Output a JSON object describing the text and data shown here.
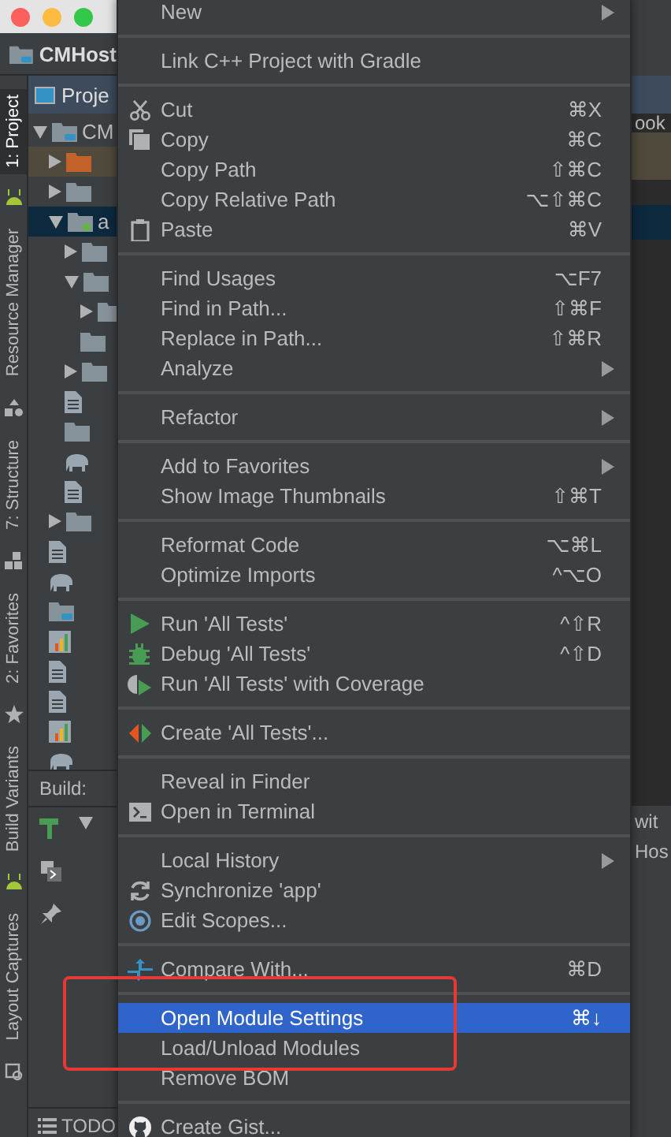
{
  "window": {
    "title": "CMHost"
  },
  "tool_tabs": [
    {
      "label": "1: Project",
      "selected": true,
      "kind": "android"
    },
    {
      "label": "Resource Manager",
      "selected": false,
      "kind": "resource"
    },
    {
      "label": "7: Structure",
      "selected": false,
      "kind": "structure"
    },
    {
      "label": "2: Favorites",
      "selected": false,
      "kind": "star"
    },
    {
      "label": "Build Variants",
      "selected": false,
      "kind": "android"
    },
    {
      "label": "Layout Captures",
      "selected": false,
      "kind": "capture"
    }
  ],
  "project_panel": {
    "title": "Proje",
    "tree": [
      {
        "kind": "module",
        "label": "CM",
        "expanded": true,
        "selected": false,
        "children": [
          {
            "kind": "excluded",
            "expanded": false,
            "selected": false
          },
          {
            "kind": "folder",
            "expanded": false,
            "selected": false
          },
          {
            "kind": "app",
            "label": "a",
            "expanded": true,
            "selected": true,
            "children": [
              {
                "kind": "folder",
                "expanded": false,
                "selected": false
              },
              {
                "kind": "folder",
                "expanded": true,
                "selected": false,
                "children": [
                  {
                    "kind": "folder",
                    "expanded": false,
                    "selected": false
                  },
                  {
                    "kind": "folder",
                    "selected": false
                  }
                ]
              },
              {
                "kind": "folder",
                "expanded": false,
                "selected": false
              },
              {
                "kind": "file",
                "selected": false
              },
              {
                "kind": "folder",
                "selected": false
              },
              {
                "kind": "gradle",
                "selected": false
              },
              {
                "kind": "file",
                "selected": false
              }
            ]
          },
          {
            "kind": "folder",
            "expanded": false,
            "selected": false
          },
          {
            "kind": "file",
            "selected": false
          },
          {
            "kind": "gradle",
            "selected": false
          },
          {
            "kind": "module",
            "selected": false
          },
          {
            "kind": "chart",
            "selected": false
          },
          {
            "kind": "file",
            "selected": false
          },
          {
            "kind": "file",
            "selected": false
          },
          {
            "kind": "chart",
            "selected": false
          },
          {
            "kind": "gradle",
            "selected": false
          }
        ]
      }
    ]
  },
  "build_panel": {
    "label": "Build:"
  },
  "status_bar": {
    "label": "TODO"
  },
  "right_fragments": [
    {
      "text": "ook"
    },
    {
      "text": "wit"
    },
    {
      "text": "Hos"
    }
  ],
  "context_menu": [
    [
      {
        "label": "New",
        "submenu": true
      }
    ],
    [
      {
        "label": "Link C++ Project with Gradle"
      }
    ],
    [
      {
        "label": "Cut",
        "shortcut": "⌘X",
        "kind": "cut"
      },
      {
        "label": "Copy",
        "shortcut": "⌘C",
        "kind": "copy"
      },
      {
        "label": "Copy Path",
        "shortcut": "⇧⌘C"
      },
      {
        "label": "Copy Relative Path",
        "shortcut": "⌥⇧⌘C"
      },
      {
        "label": "Paste",
        "shortcut": "⌘V",
        "kind": "paste"
      }
    ],
    [
      {
        "label": "Find Usages",
        "shortcut": "⌥F7"
      },
      {
        "label": "Find in Path...",
        "shortcut": "⇧⌘F"
      },
      {
        "label": "Replace in Path...",
        "shortcut": "⇧⌘R"
      },
      {
        "label": "Analyze",
        "submenu": true
      }
    ],
    [
      {
        "label": "Refactor",
        "submenu": true
      }
    ],
    [
      {
        "label": "Add to Favorites",
        "submenu": true
      },
      {
        "label": "Show Image Thumbnails",
        "shortcut": "⇧⌘T"
      }
    ],
    [
      {
        "label": "Reformat Code",
        "shortcut": "⌥⌘L"
      },
      {
        "label": "Optimize Imports",
        "shortcut": "^⌥O"
      }
    ],
    [
      {
        "label": "Run 'All Tests'",
        "shortcut": "^⇧R",
        "kind": "run"
      },
      {
        "label": "Debug 'All Tests'",
        "shortcut": "^⇧D",
        "kind": "debug"
      },
      {
        "label": "Run 'All Tests' with Coverage",
        "kind": "coverage"
      }
    ],
    [
      {
        "label": "Create 'All Tests'...",
        "kind": "create-test"
      }
    ],
    [
      {
        "label": "Reveal in Finder"
      },
      {
        "label": "Open in Terminal",
        "kind": "terminal"
      }
    ],
    [
      {
        "label": "Local History",
        "submenu": true
      },
      {
        "label": "Synchronize 'app'",
        "kind": "sync"
      },
      {
        "label": "Edit Scopes...",
        "kind": "scopes"
      }
    ],
    [
      {
        "label": "Compare With...",
        "shortcut": "⌘D",
        "kind": "compare"
      }
    ],
    [
      {
        "label": "Open Module Settings",
        "shortcut": "⌘↓",
        "selected": true
      },
      {
        "label": "Load/Unload Modules",
        "selected": false
      },
      {
        "label": "Remove BOM",
        "selected": false
      }
    ],
    [
      {
        "label": "Create Gist...",
        "kind": "github"
      }
    ]
  ]
}
